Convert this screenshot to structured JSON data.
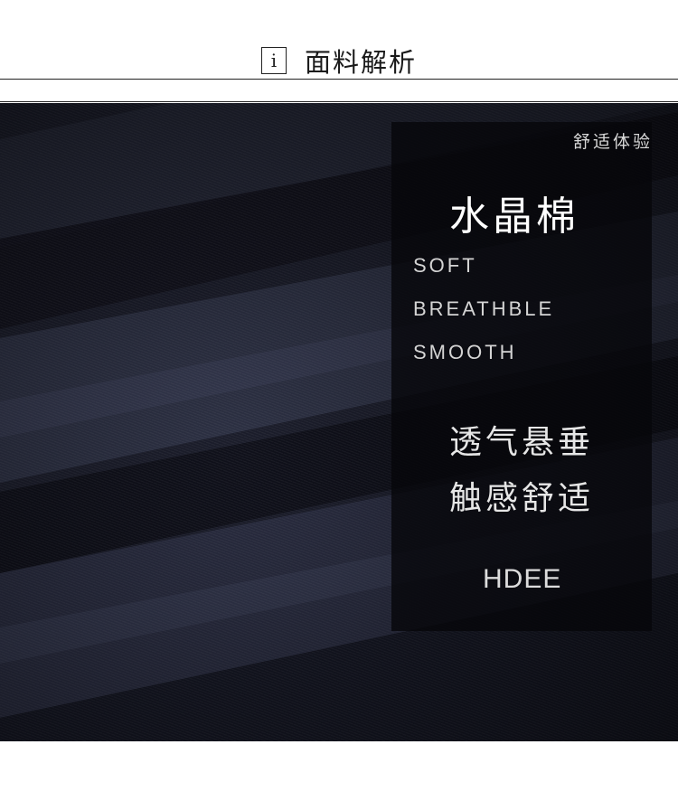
{
  "header": {
    "icon_glyph": "i",
    "icon_name": "info-icon",
    "title": "面料解析"
  },
  "panel": {
    "subtitle": "舒适体验",
    "fabric_name": "水晶棉",
    "features": [
      "SOFT",
      "BREATHBLE",
      "SMOOTH"
    ],
    "slogans": [
      "透气悬垂",
      "触感舒适"
    ],
    "brand": "HDEE"
  },
  "colors": {
    "fabric": "#1b1d2b",
    "panel": "#06060a",
    "text_light": "#ffffff"
  }
}
